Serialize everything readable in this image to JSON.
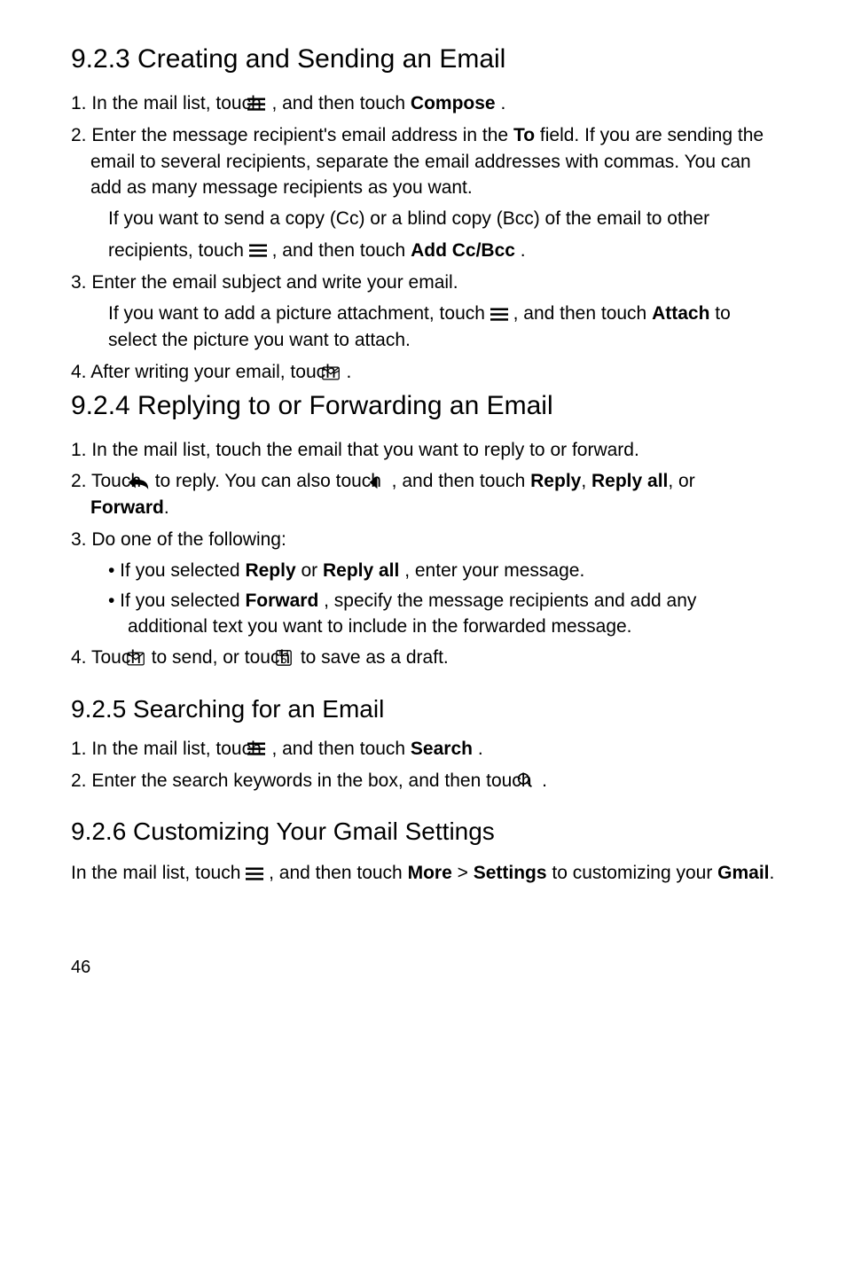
{
  "sections": {
    "s923": {
      "title": "9.2.3  Creating and Sending an Email",
      "step1_a": "1. In the mail list, touch ",
      "step1_b": " , and then touch ",
      "step1_bold": "Compose",
      "step1_c": ".",
      "step2_a": "2. Enter the message recipient's email address in the ",
      "step2_bold": "To",
      "step2_b": " field. If you are sending the email to several recipients, separate the email addresses with commas. You can add as many message recipients as you want.",
      "sub2a": "If you want to send a copy (Cc) or a blind copy (Bcc) of the email to other",
      "sub2b_a": "recipients, touch ",
      "sub2b_b": " , and then touch ",
      "sub2b_bold": "Add Cc/Bcc",
      "sub2b_c": ".",
      "step3": "3. Enter the email subject and write your email.",
      "sub3_a": "If you want to add a picture attachment, touch ",
      "sub3_b": " , and then touch ",
      "sub3_bold": "Attach",
      "sub3_c": " to select the picture you want to attach.",
      "step4_a": "4. After writing your email, touch ",
      "step4_b": " ."
    },
    "s924": {
      "title": "9.2.4  Replying to or Forwarding an Email",
      "step1": "1. In the mail list, touch the email that you want to reply to or forward.",
      "step2_a": "2. Touch ",
      "step2_b": " to reply. You can also touch ",
      "step2_c": " , and then touch ",
      "step2_bold1": "Reply",
      "step2_d": ", ",
      "step2_bold2": "Reply all",
      "step2_e": ", or ",
      "step2_bold3": "Forward",
      "step2_f": ".",
      "step3": "3. Do one of the following:",
      "bullet1_a": "•  If you selected ",
      "bullet1_bold1": "Reply",
      "bullet1_b": " or ",
      "bullet1_bold2": "Reply all",
      "bullet1_c": ", enter your message.",
      "bullet2_a": "•  If you selected ",
      "bullet2_bold": "Forward",
      "bullet2_b": ", specify the message recipients and add any additional text you want to include in the forwarded message.",
      "step4_a": "4. Touch ",
      "step4_b": " to send, or touch ",
      "step4_c": " to save as a draft."
    },
    "s925": {
      "title": "9.2.5  Searching for an Email",
      "step1_a": "1. In the mail list, touch ",
      "step1_b": " , and then touch ",
      "step1_bold": "Search",
      "step1_c": ".",
      "step2_a": "2. Enter the search keywords in the box, and then touch ",
      "step2_b": " ."
    },
    "s926": {
      "title": "9.2.6  Customizing Your Gmail Settings",
      "para_a": "In the mail list, touch ",
      "para_b": " , and then touch ",
      "para_bold1": "More",
      "para_c": " > ",
      "para_bold2": "Settings",
      "para_d": " to customizing your ",
      "para_bold3": "Gmail",
      "para_e": "."
    }
  },
  "page_number": "46"
}
